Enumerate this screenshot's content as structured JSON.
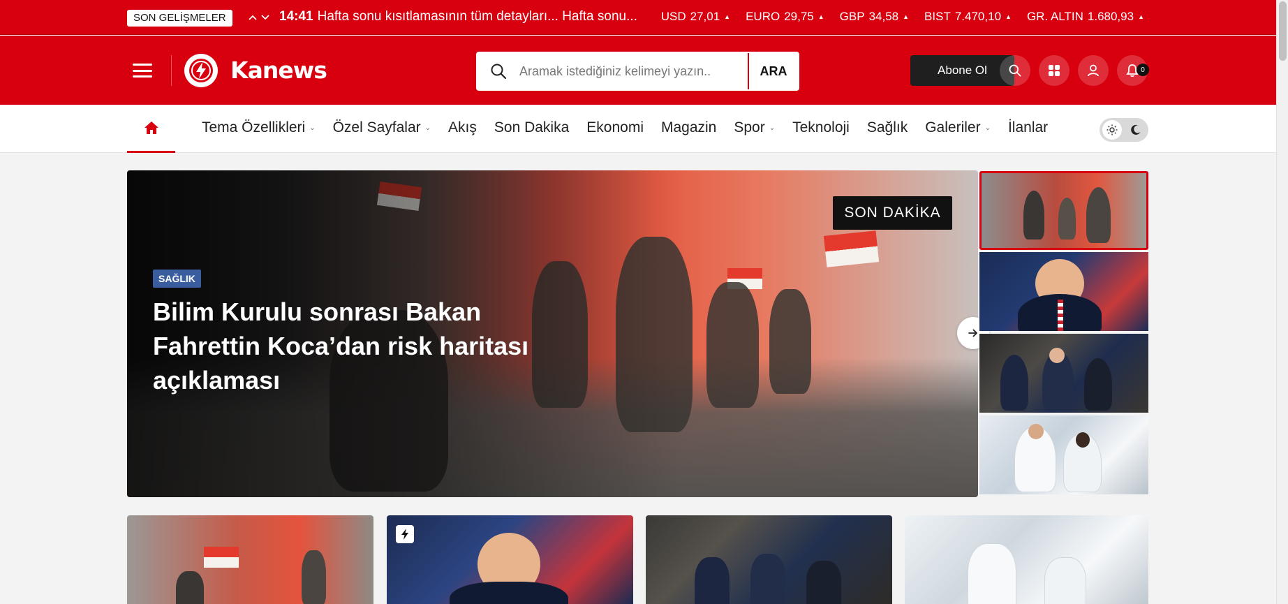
{
  "ticker": {
    "label": "SON GELİŞMELER",
    "time": "14:41",
    "headline": "Hafta sonu kısıtlamasının tüm detayları... Hafta sonu...",
    "markets": [
      {
        "name": "USD",
        "value": "27,01"
      },
      {
        "name": "EURO",
        "value": "29,75"
      },
      {
        "name": "GBP",
        "value": "34,58"
      },
      {
        "name": "BIST",
        "value": "7.470,10"
      },
      {
        "name": "GR. ALTIN",
        "value": "1.680,93"
      }
    ]
  },
  "header": {
    "logo_text": "Kanews",
    "search_placeholder": "Aramak istediğiniz kelimeyi yazın..",
    "search_button": "ARA",
    "subscribe_label": "Abone Ol",
    "notification_count": "0"
  },
  "nav": {
    "items": [
      {
        "label": "Tema Özellikleri",
        "dropdown": true
      },
      {
        "label": "Özel Sayfalar",
        "dropdown": true
      },
      {
        "label": "Akış",
        "dropdown": false
      },
      {
        "label": "Son Dakika",
        "dropdown": false
      },
      {
        "label": "Ekonomi",
        "dropdown": false
      },
      {
        "label": "Magazin",
        "dropdown": false
      },
      {
        "label": "Spor",
        "dropdown": true
      },
      {
        "label": "Teknoloji",
        "dropdown": false
      },
      {
        "label": "Sağlık",
        "dropdown": false
      },
      {
        "label": "Galeriler",
        "dropdown": true
      },
      {
        "label": "İlanlar",
        "dropdown": false
      }
    ]
  },
  "hero": {
    "badge": "SON DAKİKA",
    "category": "SAĞLIK",
    "title": "Bilim Kurulu sonrası Bakan Fahrettin Koca’dan risk haritası açıklaması"
  },
  "colors": {
    "brand": "#d8000f",
    "dark": "#1f1f1f",
    "category": "#3a5da0"
  },
  "icons": [
    "menu-icon",
    "logo-bolt-icon",
    "search-icon",
    "grid-icon",
    "user-icon",
    "bell-icon",
    "home-icon",
    "sun-icon",
    "moon-icon",
    "arrow-right-icon",
    "bolt-icon"
  ]
}
